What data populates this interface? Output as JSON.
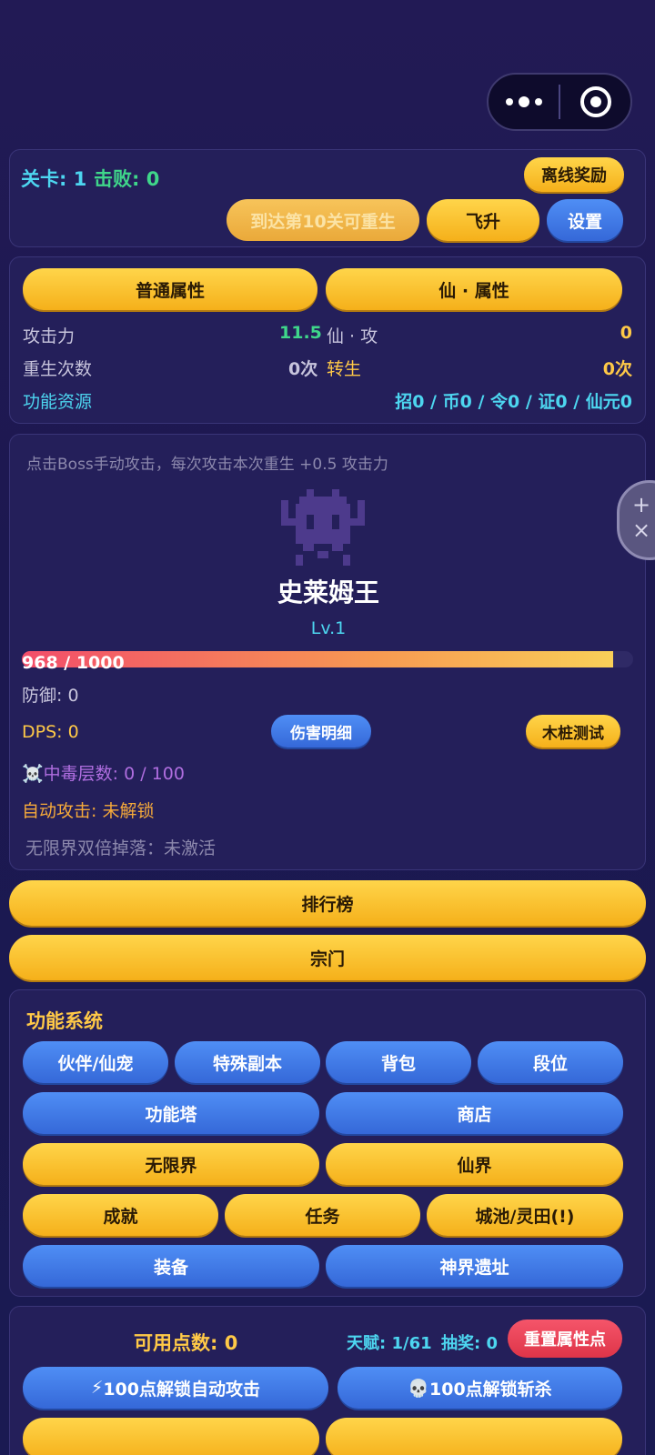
{
  "header": {
    "level_label": "关卡: 1",
    "defeat_label": "击败: 0",
    "offline_reward": "离线奖励",
    "rebirth_hint": "到达第10关可重生",
    "ascend": "飞升",
    "settings": "设置"
  },
  "attributes": {
    "tab_normal": "普通属性",
    "tab_immortal": "仙 · 属性",
    "attack_label": "攻击力",
    "attack_value": "11.5",
    "immortal_attack_label": "仙 · 攻",
    "immortal_attack_value": "0",
    "rebirth_count_label": "重生次数",
    "rebirth_count_value": "0次",
    "reincarnation_label": "转生",
    "reincarnation_value": "0次",
    "resources_label": "功能资源",
    "resources_value": "招0 / 币0 / 令0 / 证0 / 仙元0"
  },
  "boss": {
    "hint": "点击Boss手动攻击，每次攻击本次重生 +0.5 攻击力",
    "name": "史莱姆王",
    "level": "Lv.1",
    "hp_text": "968 / 1000",
    "hp_fraction": 0.968,
    "defense": "防御: 0",
    "dps": "DPS: 0",
    "damage_detail": "伤害明细",
    "dummy_test": "木桩测试",
    "poison_icon": "☠️",
    "poison": "中毒层数: 0 / 100",
    "auto_attack": "自动攻击: 未解锁",
    "double_drop": "无限界双倍掉落：未激活"
  },
  "side_bubble": {
    "line1": "+",
    "line2": "×"
  },
  "main_buttons": {
    "ranking": "排行榜",
    "sect": "宗门"
  },
  "functions": {
    "title": "功能系统",
    "partner": "伙伴/仙宠",
    "special_dungeon": "特殊副本",
    "backpack": "背包",
    "rank": "段位",
    "function_tower": "功能塔",
    "shop": "商店",
    "infinite_realm": "无限界",
    "immortal_realm": "仙界",
    "achievement": "成就",
    "task": "任务",
    "city_field": "城池/灵田(!)",
    "equipment": "装备",
    "divine_ruins": "神界遗址"
  },
  "points": {
    "available": "可用点数: 0",
    "talent": "天赋: 1/61",
    "lottery": "抽奖: 0",
    "reset": "重置属性点",
    "unlock_auto_icon": "⚡",
    "unlock_auto": "100点解锁自动攻击",
    "unlock_execute_icon": "💀",
    "unlock_execute": "100点解锁斩杀"
  },
  "colors": {
    "gold": "#f5b01a",
    "blue": "#3568d8",
    "red": "#de3448",
    "cyan": "#4dd6f0",
    "green": "#3fd68a",
    "background": "#1c1850"
  }
}
